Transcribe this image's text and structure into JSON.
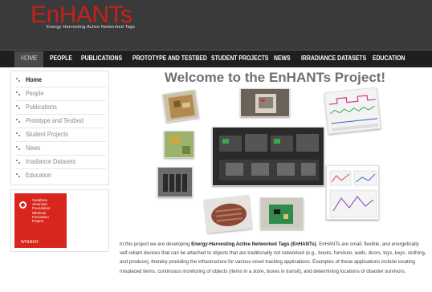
{
  "header": {
    "logo": "EnHANTs",
    "tagline": "Energy Harvesting Active Networked Tags"
  },
  "nav": {
    "items": [
      {
        "label": "HOME"
      },
      {
        "label": "PEOPLE"
      },
      {
        "label": "PUBLICATIONS"
      },
      {
        "label": "PROTOTYPE AND TESTBED"
      },
      {
        "label": "STUDENT PROJECTS"
      },
      {
        "label": "NEWS"
      },
      {
        "label": "IRRADIANCE DATASETS"
      },
      {
        "label": "EDUCATION"
      }
    ]
  },
  "sidebar": {
    "items": [
      {
        "label": "Home"
      },
      {
        "label": "People"
      },
      {
        "label": "Publications"
      },
      {
        "label": "Prototype and Testbed"
      },
      {
        "label": "Student Projects"
      },
      {
        "label": "News"
      },
      {
        "label": "Irradiance Datasets"
      },
      {
        "label": "Education"
      }
    ]
  },
  "badge": {
    "lines": [
      "Vodafone",
      "Americas",
      "Foundation",
      "Wireless",
      "Innovation",
      "Project"
    ],
    "winner": "WINNER"
  },
  "main": {
    "title": "Welcome to the EnHANTs Project!",
    "intro_lead": "In this project we are developing ",
    "intro_bold": "Energy-Harvesting Active Networked Tags (EnHANTs)",
    "intro_rest": ". EnHANTs are small, flexible, and energetically self-reliant devices that can be attached to objects that are traditionally not networked (e.g., books, furniture, walls, doors, toys, keys, clothing, and produce), thereby providing the infrastructure for various novel tracking applications. Examples of these applications include locating misplaced items, continuous monitoring of objects (items in a store, boxes in transit), and determining locations of disaster survivors."
  },
  "colors": {
    "header_bg": "#3a3a3a",
    "nav_bg": "#1f1f1f",
    "logo_red": "#c8201b",
    "badge_red": "#d9261c"
  }
}
